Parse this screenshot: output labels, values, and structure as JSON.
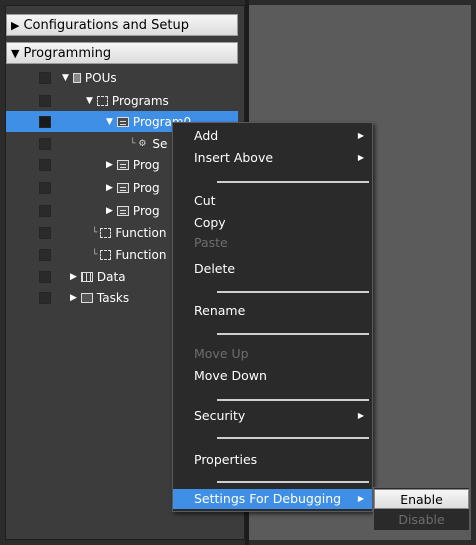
{
  "sections": {
    "config_label": "Configurations and Setup",
    "programming_label": "Programming"
  },
  "tree": {
    "pous": "POUs",
    "programs": "Programs",
    "program0": "Program0",
    "section_child": "Se",
    "prog_a": "Prog",
    "prog_b": "Prog",
    "prog_c": "Prog",
    "functions_a": "Function",
    "functions_b": "Function",
    "data": "Data",
    "tasks": "Tasks"
  },
  "context_menu": {
    "add": "Add",
    "insert_above": "Insert Above",
    "cut": "Cut",
    "copy": "Copy",
    "paste": "Paste",
    "delete": "Delete",
    "rename": "Rename",
    "move_up": "Move Up",
    "move_down": "Move Down",
    "security": "Security",
    "properties": "Properties",
    "settings_for_debugging": "Settings For Debugging"
  },
  "submenu": {
    "enable": "Enable",
    "disable": "Disable"
  },
  "colors": {
    "selection": "#3f8fe6",
    "menu_bg": "#2a2a2a",
    "right_pane": "#5b5b5b"
  }
}
